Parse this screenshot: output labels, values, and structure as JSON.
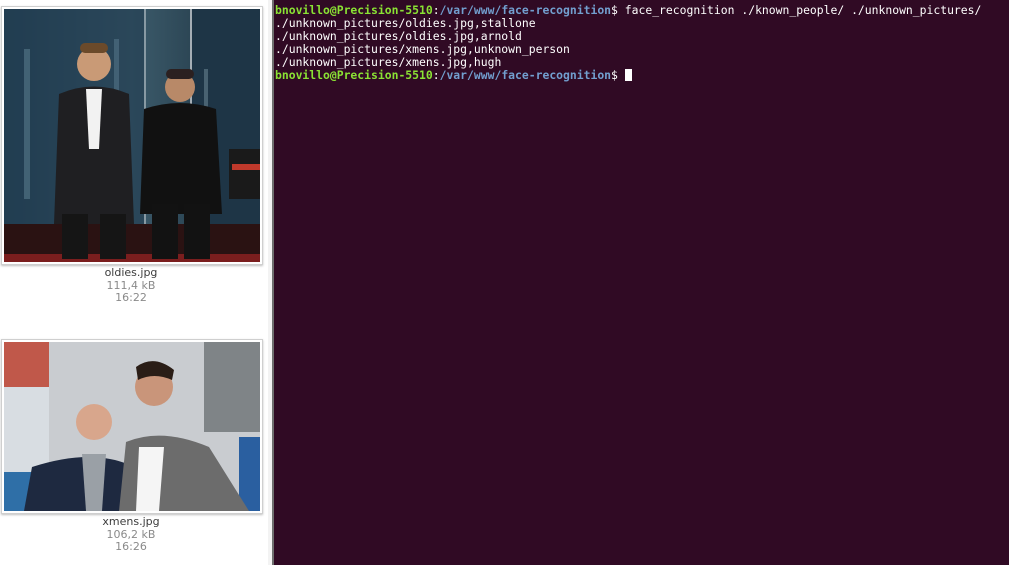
{
  "files": [
    {
      "name": "oldies.jpg",
      "size": "111,4 kB",
      "time": "16:22"
    },
    {
      "name": "xmens.jpg",
      "size": "106,2 kB",
      "time": "16:26"
    }
  ],
  "terminal": {
    "bg_color": "#300a24",
    "prompt_user": "bnovillo@Precision-5510",
    "prompt_sep": ":",
    "prompt_path": "/var/www/face-recognition",
    "prompt_symbol": "$ ",
    "command": "face_recognition ./known_people/ ./unknown_pictures/",
    "output": [
      "./unknown_pictures/oldies.jpg,stallone",
      "./unknown_pictures/oldies.jpg,arnold",
      "./unknown_pictures/xmens.jpg,unknown_person",
      "./unknown_pictures/xmens.jpg,hugh"
    ]
  }
}
